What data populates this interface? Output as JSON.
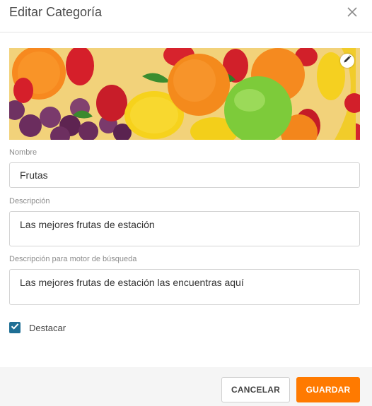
{
  "dialog": {
    "title": "Editar Categoría",
    "close_icon": "close-icon",
    "edit_image_icon": "pencil-icon"
  },
  "form": {
    "name_label": "Nombre",
    "name_value": "Frutas",
    "description_label": "Descripción",
    "description_value": "Las mejores frutas de estación",
    "seo_label": "Descripción para motor de búsqueda",
    "seo_value": "Las mejores frutas de estación las encuentras aquí",
    "featured_label": "Destacar",
    "featured_checked": true
  },
  "footer": {
    "cancel_label": "CANCELAR",
    "save_label": "GUARDAR"
  },
  "colors": {
    "accent": "#ff7a00",
    "checkbox": "#1f6f95"
  }
}
